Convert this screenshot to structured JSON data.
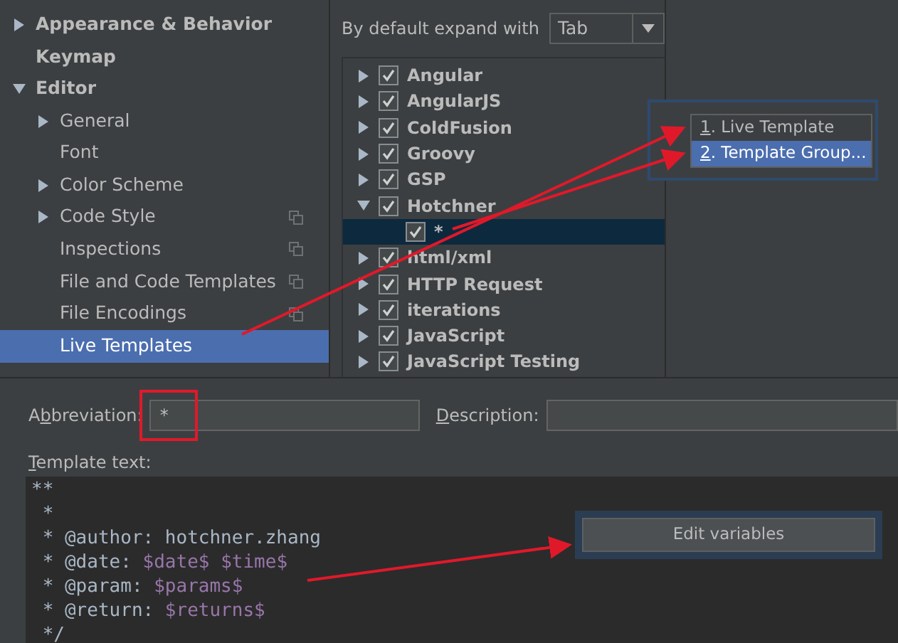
{
  "sidebar": {
    "items": [
      {
        "label": "Appearance & Behavior",
        "expanded": false,
        "selected": false
      },
      {
        "label": "Keymap",
        "selected": false
      },
      {
        "label": "Editor",
        "expanded": true,
        "selected": false,
        "children": [
          {
            "label": "General",
            "expanded": false,
            "selected": false
          },
          {
            "label": "Font",
            "selected": false
          },
          {
            "label": "Color Scheme",
            "expanded": false,
            "selected": false
          },
          {
            "label": "Code Style",
            "expanded": false,
            "scheme_icon": true,
            "selected": false
          },
          {
            "label": "Inspections",
            "scheme_icon": true,
            "selected": false
          },
          {
            "label": "File and Code Templates",
            "scheme_icon": true,
            "selected": false
          },
          {
            "label": "File Encodings",
            "scheme_icon": true,
            "selected": false
          },
          {
            "label": "Live Templates",
            "selected": true
          }
        ]
      }
    ]
  },
  "expand_with": {
    "label": "By default expand with",
    "value": "Tab"
  },
  "template_groups": [
    {
      "label": "Angular",
      "checked": true,
      "expanded": false
    },
    {
      "label": "AngularJS",
      "checked": true,
      "expanded": false
    },
    {
      "label": "ColdFusion",
      "checked": true,
      "expanded": false
    },
    {
      "label": "Groovy",
      "checked": true,
      "expanded": false
    },
    {
      "label": "GSP",
      "checked": true,
      "expanded": false
    },
    {
      "label": "Hotchner",
      "checked": true,
      "expanded": true,
      "children": [
        {
          "label": "*",
          "checked": true,
          "selected": true
        }
      ]
    },
    {
      "label": "html/xml",
      "checked": true,
      "expanded": false
    },
    {
      "label": "HTTP Request",
      "checked": true,
      "expanded": false
    },
    {
      "label": "iterations",
      "checked": true,
      "expanded": false
    },
    {
      "label": "JavaScript",
      "checked": true,
      "expanded": false
    },
    {
      "label": "JavaScript Testing",
      "checked": true,
      "expanded": false
    }
  ],
  "add_menu": {
    "items": [
      {
        "mnemonic": "1",
        "label": ". Live Template",
        "selected": false
      },
      {
        "mnemonic": "2",
        "label": ". Template Group...",
        "selected": true
      }
    ]
  },
  "abbreviation": {
    "mnemonic_before": "A",
    "mnemonic": "b",
    "label_after": "breviation:",
    "value": "*"
  },
  "description": {
    "mnemonic": "D",
    "label_after": "escription:"
  },
  "template_text": {
    "mnemonic": "T",
    "label_after": "emplate text:",
    "lines": [
      [
        {
          "kind": "plain",
          "text": "**"
        }
      ],
      [
        {
          "kind": "plain",
          "text": " *"
        }
      ],
      [
        {
          "kind": "plain",
          "text": " * @author: hotchner.zhang"
        }
      ],
      [
        {
          "kind": "plain",
          "text": " * @date: "
        },
        {
          "kind": "var",
          "text": "$date$ $time$"
        }
      ],
      [
        {
          "kind": "plain",
          "text": " * @param: "
        },
        {
          "kind": "var",
          "text": "$params$"
        }
      ],
      [
        {
          "kind": "plain",
          "text": " * @return: "
        },
        {
          "kind": "var",
          "text": "$returns$"
        }
      ],
      [
        {
          "kind": "plain",
          "text": " */"
        }
      ]
    ]
  },
  "edit_variables_button": "Edit variables"
}
